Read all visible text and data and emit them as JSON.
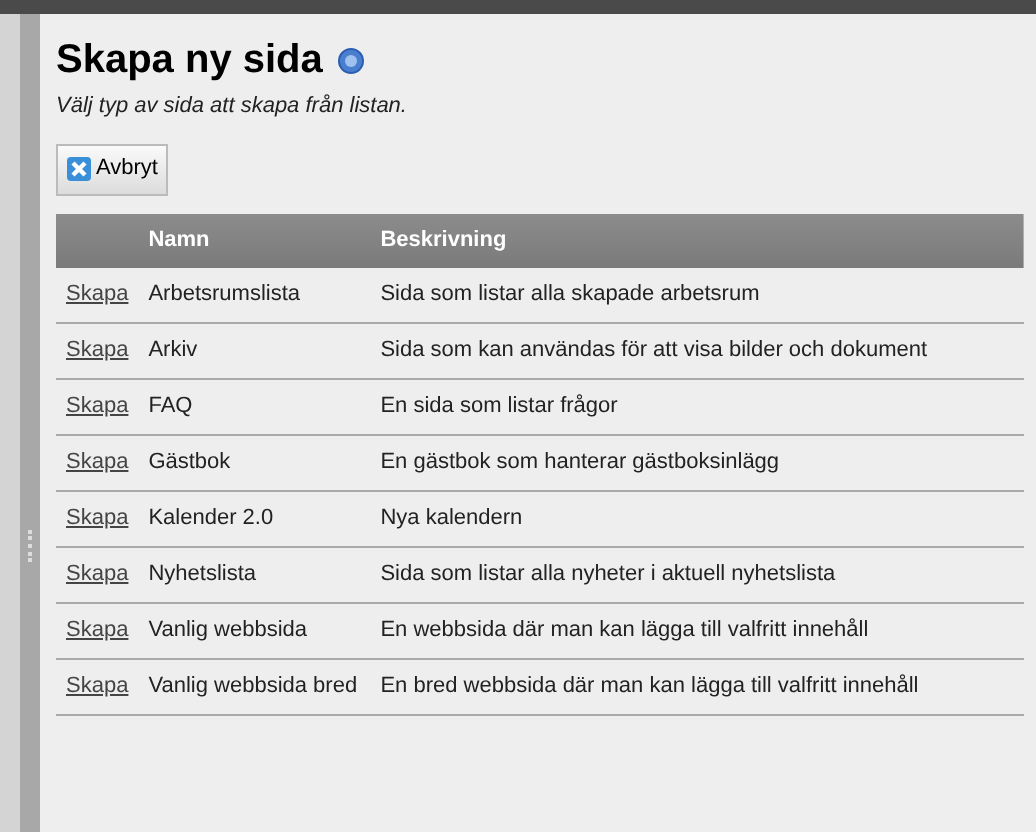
{
  "page": {
    "title": "Skapa ny sida",
    "subtitle": "Välj typ av sida att skapa från listan."
  },
  "cancel_button": {
    "label": "Avbryt"
  },
  "table": {
    "columns": [
      "",
      "Namn",
      "Beskrivning"
    ],
    "rows": [
      {
        "action": "Skapa",
        "name": "Arbetsrumslista",
        "description": "Sida som listar alla skapade arbetsrum"
      },
      {
        "action": "Skapa",
        "name": "Arkiv",
        "description": "Sida som kan användas för att visa bilder och dokument"
      },
      {
        "action": "Skapa",
        "name": "FAQ",
        "description": "En sida som listar frågor"
      },
      {
        "action": "Skapa",
        "name": "Gästbok",
        "description": "En gästbok som hanterar gästboksinlägg"
      },
      {
        "action": "Skapa",
        "name": "Kalender 2.0",
        "description": "Nya kalendern"
      },
      {
        "action": "Skapa",
        "name": "Nyhetslista",
        "description": "Sida som listar alla nyheter i aktuell nyhetslista"
      },
      {
        "action": "Skapa",
        "name": "Vanlig webbsida",
        "description": "En webbsida där man kan lägga till valfritt innehåll"
      },
      {
        "action": "Skapa",
        "name": "Vanlig webbsida bred",
        "description": "En bred webbsida där man kan lägga till valfritt innehåll"
      }
    ]
  }
}
